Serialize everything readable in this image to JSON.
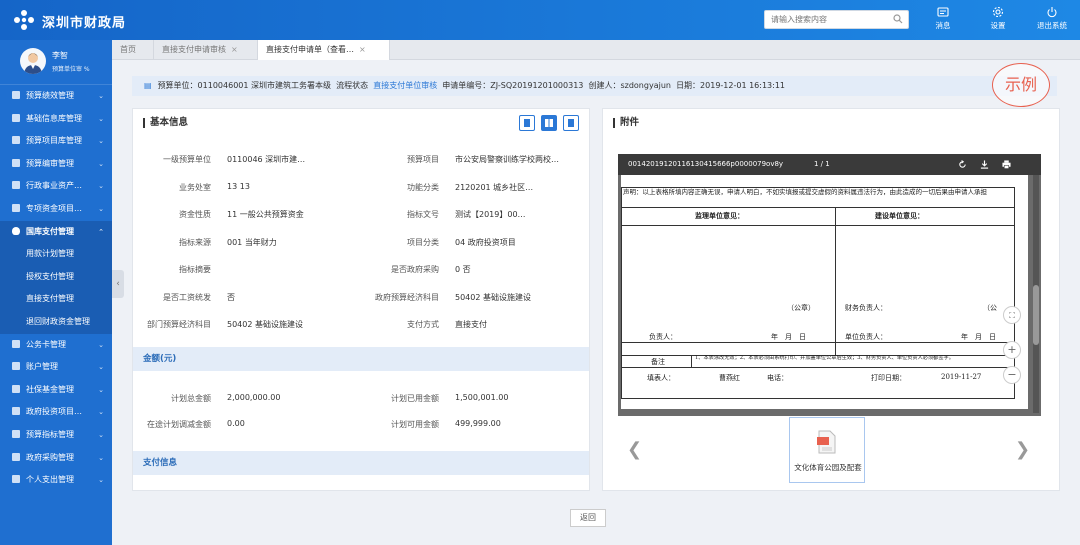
{
  "header": {
    "brand": "深圳市财政局",
    "search_placeholder": "请输入搜索内容",
    "buttons": [
      {
        "label": "消息",
        "icon": "message-icon"
      },
      {
        "label": "设置",
        "icon": "settings-icon"
      },
      {
        "label": "退出系统",
        "icon": "power-icon"
      }
    ]
  },
  "user": {
    "name": "李智",
    "role": "预算单位审 %"
  },
  "sidebar": {
    "items": [
      {
        "label": "预算绩效管理",
        "icon": "grid-icon"
      },
      {
        "label": "基础信息库管理",
        "icon": "database-icon"
      },
      {
        "label": "预算项目库管理",
        "icon": "list-icon"
      },
      {
        "label": "预算编审管理",
        "icon": "edit-icon"
      },
      {
        "label": "行政事业资产…",
        "icon": "asset-icon"
      },
      {
        "label": "专项资金项目…",
        "icon": "fund-icon"
      },
      {
        "label": "国库支付管理",
        "icon": "shield-icon",
        "active": true
      },
      {
        "label": "公务卡管理",
        "icon": "card-icon"
      },
      {
        "label": "账户管理",
        "icon": "account-icon"
      },
      {
        "label": "社保基金管理",
        "icon": "fund-icon"
      },
      {
        "label": "政府投资项目…",
        "icon": "invest-icon"
      },
      {
        "label": "预算指标管理",
        "icon": "chart-icon"
      },
      {
        "label": "政府采购管理",
        "icon": "cart-icon"
      },
      {
        "label": "个人支出管理",
        "icon": "person-icon"
      }
    ],
    "subitems": [
      "用款计划管理",
      "授权支付管理",
      "直接支付管理",
      "退回财政资金管理"
    ]
  },
  "tabs": [
    {
      "label": "首页"
    },
    {
      "label": "直接支付申请审核"
    },
    {
      "label": "直接支付申请单（查看…",
      "active": true
    }
  ],
  "infobar": {
    "unit": "预算单位：0110046001 深圳市建筑工务署本级",
    "flow_label": "流程状态",
    "flow_value": "直接支付单位审核",
    "apply_no": "申请单编号：ZJ-SQ20191201000313",
    "creator": "创建人：szdongyajun",
    "date": "日期：2019-12-01 16:13:11"
  },
  "stamp": "示例",
  "basic": {
    "title": "基本信息",
    "rows": [
      [
        "一级预算单位",
        "0110046 深圳市建…",
        "预算项目",
        "市公安局警察训练学校两校…"
      ],
      [
        "业务处室",
        "13 13",
        "功能分类",
        "2120201 城乡社区…"
      ],
      [
        "资金性质",
        "11 一般公共预算资金",
        "指标文号",
        "测试【2019】00…"
      ],
      [
        "指标来源",
        "001 当年财力",
        "项目分类",
        "04 政府投资项目"
      ],
      [
        "指标摘要",
        "",
        "是否政府采购",
        "0 否"
      ],
      [
        "是否工资统发",
        "否",
        "政府预算经济科目",
        "50402 基础设施建设"
      ],
      [
        "部门预算经济科目",
        "50402 基础设施建设",
        "支付方式",
        "直接支付"
      ]
    ]
  },
  "amount": {
    "title": "金额(元)",
    "rows": [
      [
        "计划总金额",
        "2,000,000.00",
        "计划已用金额",
        "1,500,001.00"
      ],
      [
        "在途计划调减金额",
        "0.00",
        "计划可用金额",
        "499,999.00"
      ]
    ]
  },
  "payinfo": {
    "title": "支付信息"
  },
  "attachment": {
    "title": "附件",
    "viewer_file": "00142019120116130415666p0000079ov8y",
    "viewer_page": "1 / 1",
    "doc": {
      "declaration": "声明：以上表格所填内容正确无误，申请人明白，不如实填报或提交虚假的资料属违法行为，由此造成的一切后果由申请人承担",
      "sup_header": "监理单位意见：",
      "con_header": "建设单位意见：",
      "seal": "（公章）",
      "seal2": "（公",
      "finance": "财务负责人：",
      "leader": "负责人：",
      "unit_leader": "单位负责人：",
      "date_fmt": "年　月　日",
      "note_label": "备注",
      "note_text": "1、本表涂改无效；2、本表必须由系统打印、并加盖单位公章后生效；3、财务负责人、单位负责人必须都签字。",
      "filler_label": "填表人：",
      "filler": "曹燕红",
      "phone_label": "电话：",
      "print_label": "打印日期：",
      "print_date": "2019-11-27"
    },
    "file_name": "文化体育公园及配套"
  },
  "back_label": "返回",
  "colors": {
    "brand": "#1f6fd0",
    "accent": "#2b78d6",
    "stamp": "#e8614f"
  }
}
